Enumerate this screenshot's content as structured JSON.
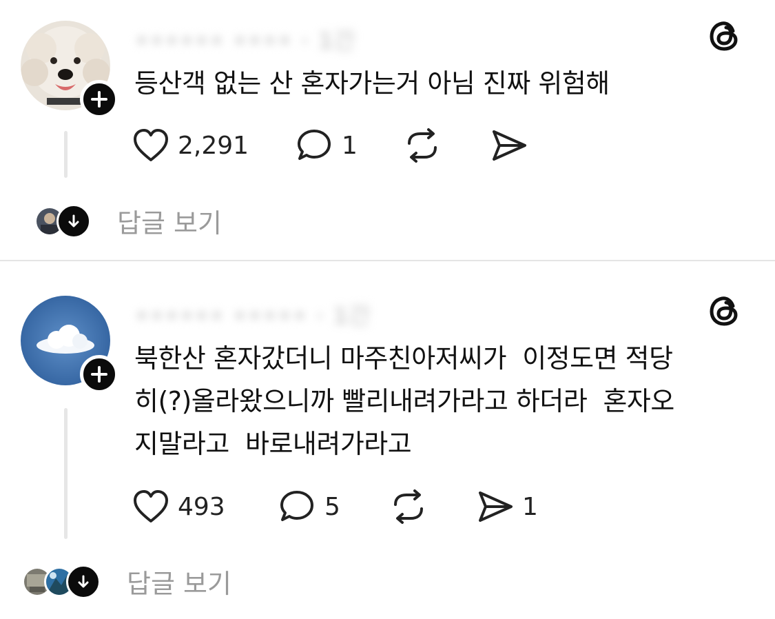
{
  "posts": [
    {
      "username": "•••••• •••• · 1간",
      "text": "등산객 없는 산 혼자가는거 아님 진짜 위험해",
      "actions": {
        "likes": "2,291",
        "comments": "1",
        "reposts": "",
        "shares": ""
      },
      "view_replies_label": "답글 보기"
    },
    {
      "username": "•••••• ••••• · 1간",
      "text": "북한산 혼자갔더니 마주친아저씨가  이정도면 적당\n히(?)올라왔으니까 빨리내려가라고 하더라  혼자오\n지말라고  바로내려가라고",
      "actions": {
        "likes": "493",
        "comments": "5",
        "reposts": "",
        "shares": "1"
      },
      "view_replies_label": "답글 보기"
    }
  ],
  "icons": {
    "like": "heart-icon",
    "comment": "comment-bubble-icon",
    "repost": "repost-icon",
    "share": "send-icon",
    "follow": "plus-icon",
    "expand": "arrow-down-icon",
    "brand": "threads-logo-icon"
  },
  "colors": {
    "text": "#111111",
    "muted": "#9a9a9a",
    "divider": "#e4e4e4",
    "badge": "#0b0b0b"
  }
}
